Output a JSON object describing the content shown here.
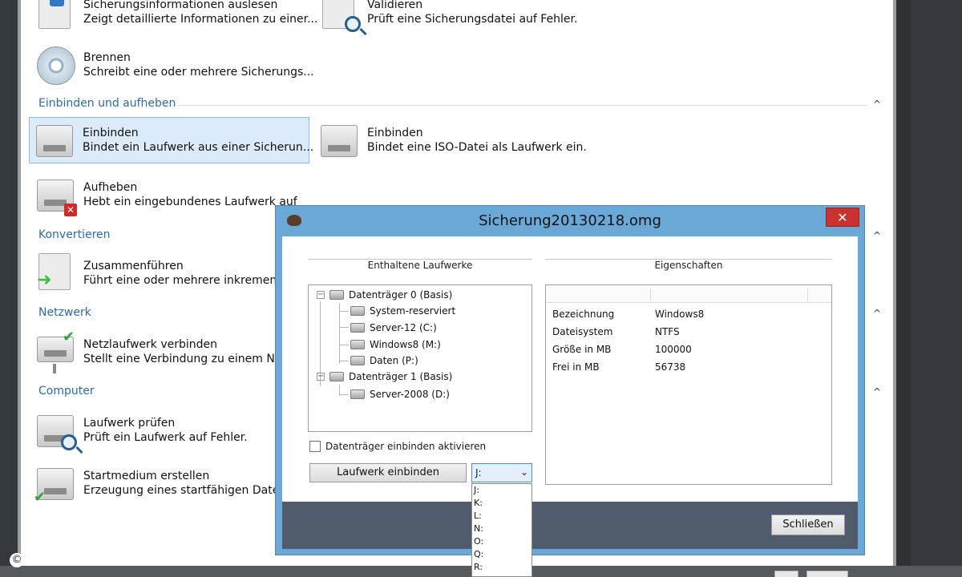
{
  "items": {
    "info": {
      "title": "Sicherungsinformationen auslesen",
      "desc": "Zeigt detaillierte Informationen zu einer..."
    },
    "validate": {
      "title": "Validieren",
      "desc": "Prüft eine Sicherungsdatei auf Fehler."
    },
    "burn": {
      "title": "Brennen",
      "desc": "Schreibt eine oder mehrere Sicherungs..."
    },
    "mount_drive": {
      "title": "Einbinden",
      "desc": "Bindet ein Laufwerk aus einer Sicherun..."
    },
    "mount_iso": {
      "title": "Einbinden",
      "desc": "Bindet eine ISO-Datei als Laufwerk ein."
    },
    "unmount": {
      "title": "Aufheben",
      "desc": "Hebt ein eingebundenes Laufwerk auf"
    },
    "merge": {
      "title": "Zusammenführen",
      "desc": "Führt eine oder mehrere inkrement"
    },
    "netdrive": {
      "title": "Netzlaufwerk verbinden",
      "desc": "Stellt eine Verbindung zu einem Ne"
    },
    "checkdrive": {
      "title": "Laufwerk prüfen",
      "desc": "Prüft ein Laufwerk auf Fehler."
    },
    "bootmedia": {
      "title": "Startmedium erstellen",
      "desc": "Erzeugung eines startfähigen Daten"
    }
  },
  "sections": {
    "mount": "Einbinden und aufheben",
    "convert": "Konvertieren",
    "network": "Netzwerk",
    "computer": "Computer"
  },
  "dialog": {
    "title": "Sicherung20130218.omg",
    "close_label": "✕",
    "drives_header": "Enthaltene Laufwerke",
    "props_header": "Eigenschaften",
    "tree": [
      {
        "label": "Datenträger 0 (Basis)",
        "level": 0
      },
      {
        "label": "System-reserviert",
        "level": 1
      },
      {
        "label": "Server-12 (C:)",
        "level": 1
      },
      {
        "label": "Windows8 (M:)",
        "level": 1
      },
      {
        "label": "Daten (P:)",
        "level": 1
      },
      {
        "label": "Datenträger 1 (Basis)",
        "level": 0
      },
      {
        "label": "Server-2008 (D:)",
        "level": 1
      }
    ],
    "properties": [
      {
        "key": "Bezeichnung",
        "value": "Windows8"
      },
      {
        "key": "Dateisystem",
        "value": "NTFS"
      },
      {
        "key": "Größe in MB",
        "value": "100000"
      },
      {
        "key": "Frei in MB",
        "value": "56738"
      }
    ],
    "checkbox_label": "Datenträger einbinden aktivieren",
    "mount_button": "Laufwerk einbinden",
    "drive_letter": "J:",
    "drive_options": [
      "J:",
      "K:",
      "L:",
      "N:",
      "O:",
      "Q:",
      "R:"
    ],
    "close_button": "Schließen"
  },
  "copyright_symbol": "©",
  "caret_up": "^",
  "expander_minus": "−",
  "dropdown_arrow": "⌄"
}
